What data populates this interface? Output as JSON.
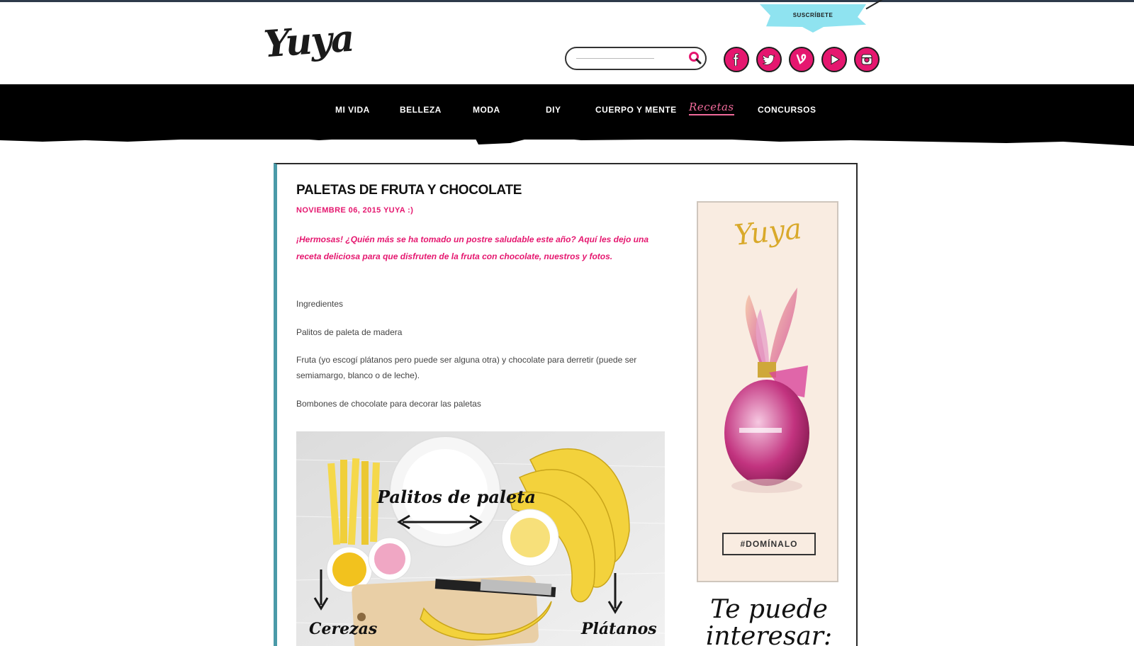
{
  "header": {
    "logo": "Yuya",
    "subscribe_label": "SUSCRÍBETE",
    "search": {
      "value": "",
      "placeholder": ""
    }
  },
  "social": [
    {
      "name": "facebook-icon"
    },
    {
      "name": "twitter-icon"
    },
    {
      "name": "vine-icon"
    },
    {
      "name": "youtube-icon"
    },
    {
      "name": "instagram-icon"
    }
  ],
  "nav": {
    "items": [
      "Mi Vida",
      "Belleza",
      "Moda",
      "DIY",
      "Cuerpo y Mente",
      "Recetas",
      "Concursos"
    ],
    "active": "Recetas"
  },
  "post": {
    "title": "PALETAS DE FRUTA Y CHOCOLATE",
    "meta": "NOVIEMBRE 06, 2015     YUYA :)",
    "intro": "¡Hermosas! ¿Quién más se ha tomado un postre saludable este año? Aquí les dejo una receta deliciosa para que disfruten de la fruta con chocolate, nuestros y fotos.",
    "paragraphs": [
      "Ingredientes",
      "Palitos de paleta de madera",
      "Fruta (yo escogí plátanos pero puede ser alguna otra) y chocolate para derretir (puede ser semiamargo, blanco o de leche).",
      "Bombones de chocolate para decorar las paletas"
    ],
    "photo_labels": {
      "sticks": "Palitos de paleta",
      "cherries": "Cerezas",
      "bananas": "Plátanos"
    }
  },
  "ad": {
    "logo": "Yuya",
    "button": "#DOMÍNALO"
  },
  "related": {
    "title": "Te puede interesar:"
  },
  "colors": {
    "accent": "#e5176f",
    "nav_bg": "#000000",
    "card_border_left": "#4a9aa8",
    "subscribe_bg": "#8fe3f0",
    "ad_bg": "#f9ece1"
  }
}
